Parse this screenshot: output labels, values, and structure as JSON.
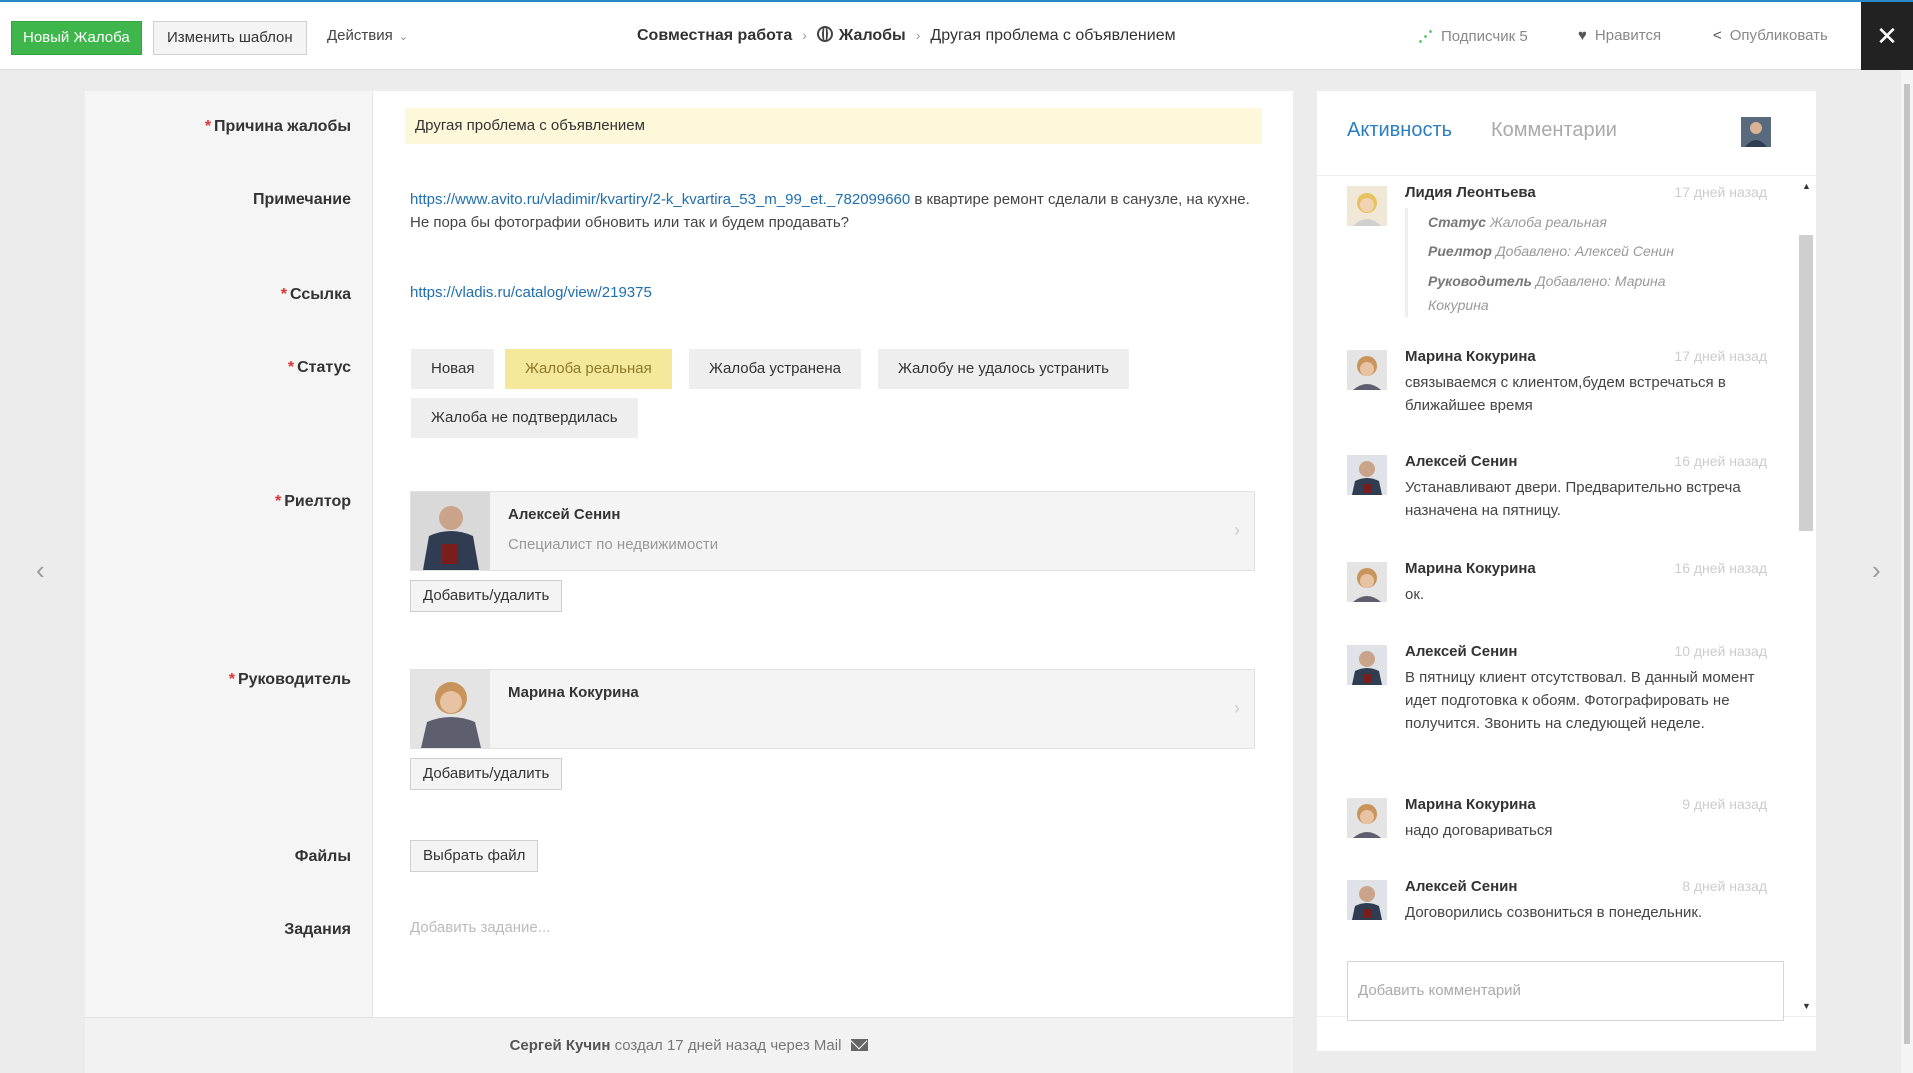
{
  "header": {
    "new_button": "Новый Жалоба",
    "template_button": "Изменить шаблон",
    "actions_menu": "Действия",
    "breadcrumb": [
      "Совместная работа",
      "Жалобы",
      "Другая проблема с объявлением"
    ],
    "subscribers_label": "Подписчик",
    "subscribers_count": "5",
    "like_label": "Нравится",
    "publish_label": "Опубликовать",
    "close_symbol": "✕"
  },
  "form": {
    "labels": {
      "reason": "Причина жалобы",
      "note": "Примечание",
      "link": "Ссылка",
      "status": "Статус",
      "realtor": "Риелтор",
      "manager": "Руководитель",
      "files": "Файлы",
      "tasks": "Задания"
    },
    "reason_value": "Другая проблема с объявлением",
    "note_link": "https://www.avito.ru/vladimir/kvartiry/2-k_kvartira_53_m_99_et._782099660",
    "note_text": " в квартире ремонт сделали в санузле, на кухне. Не пора бы фотографии обновить или так и будем продавать?",
    "link_value": "https://vladis.ru/catalog/view/219375",
    "statuses": [
      "Новая",
      "Жалоба реальная",
      "Жалоба устранена",
      "Жалобу не удалось устранить",
      "Жалоба не подтвердилась"
    ],
    "active_status": "Жалоба реальная",
    "realtor": {
      "name": "Алексей Сенин",
      "role": "Специалист по недвижимости"
    },
    "manager": {
      "name": "Марина Кокурина",
      "role": ""
    },
    "add_remove_button": "Добавить/удалить",
    "choose_file_button": "Выбрать файл",
    "task_placeholder": "Добавить задание...",
    "footer": {
      "author": "Сергей Кучин",
      "text": "создал 17 дней назад через Mail"
    }
  },
  "activity": {
    "tab_activity": "Активность",
    "tab_comments": "Комментарии",
    "entries": [
      {
        "name": "Лидия Леонтьева",
        "time": "17 дней назад",
        "details": [
          {
            "key": "Статус",
            "value": "Жалоба реальная"
          },
          {
            "key": "Риелтор",
            "value": "Добавлено: Алексей Сенин"
          },
          {
            "key": "Руководитель",
            "value": "Добавлено: Марина Кокурина"
          }
        ]
      },
      {
        "name": "Марина Кокурина",
        "time": "17 дней назад",
        "text": "связываемся с клиентом,будем встречаться в ближайшее время"
      },
      {
        "name": "Алексей Сенин",
        "time": "16 дней назад",
        "text": "Устанавливают двери. Предварительно встреча назначена на пятницу."
      },
      {
        "name": "Марина Кокурина",
        "time": "16 дней назад",
        "text": "ок."
      },
      {
        "name": "Алексей Сенин",
        "time": "10 дней назад",
        "text": "В пятницу клиент отсутствовал. В данный момент идет подготовка к обоям. Фотографировать не получится. Звонить на следующей неделе."
      },
      {
        "name": "Марина Кокурина",
        "time": "9 дней назад",
        "text": "надо договариваться"
      },
      {
        "name": "Алексей Сенин",
        "time": "8 дней назад",
        "text": "Договорились созвониться в понедельник."
      }
    ],
    "comment_placeholder": "Добавить комментарий"
  },
  "colors": {
    "accent": "#2a7fc3",
    "new_button": "#3eb64b",
    "active_status": "#f6e89a",
    "required": "#e03030"
  },
  "icons": [
    "rss-icon",
    "heart-icon",
    "share-icon",
    "close-icon",
    "globe-icon",
    "mail-icon",
    "chevron-left-icon",
    "chevron-right-icon"
  ]
}
